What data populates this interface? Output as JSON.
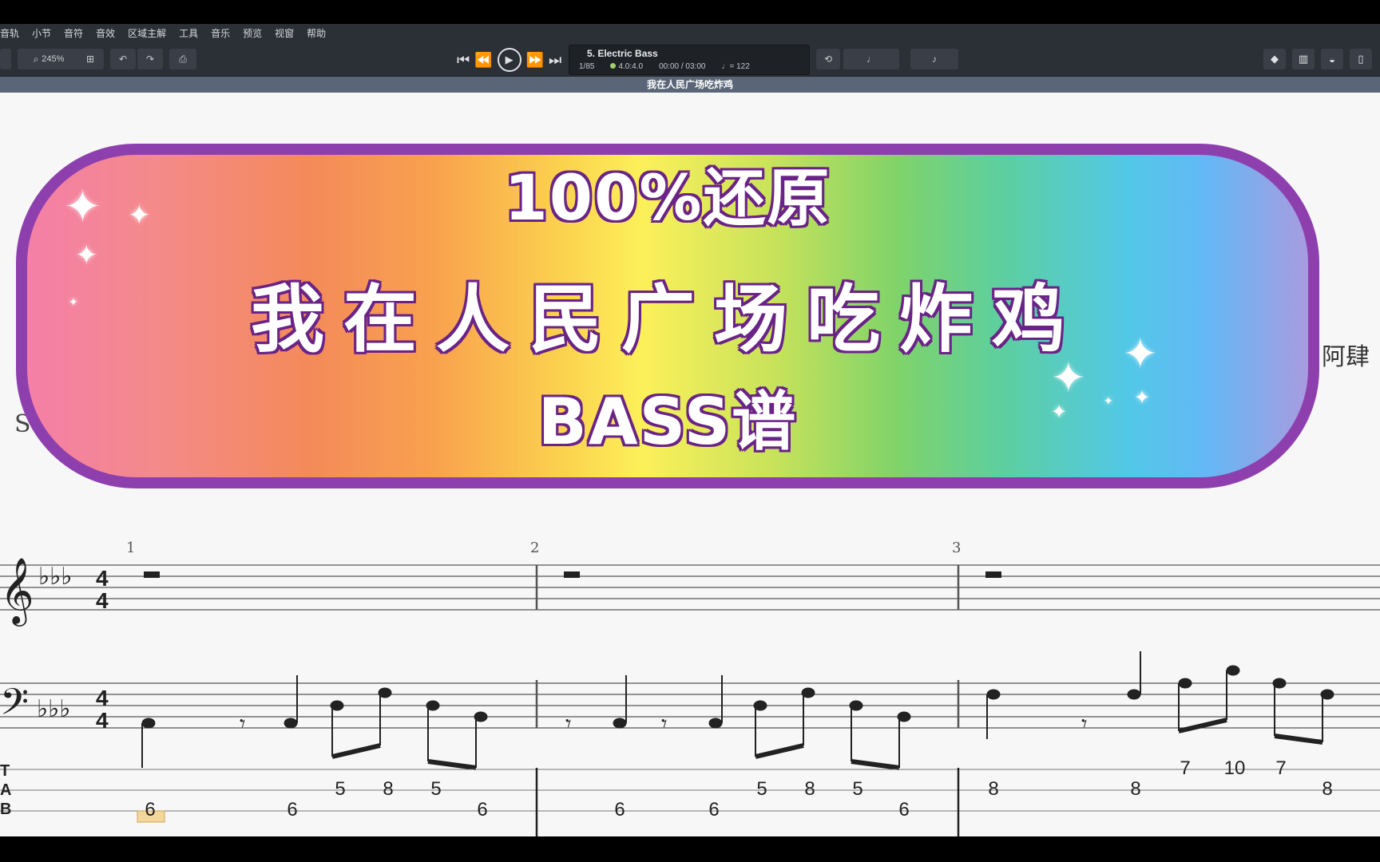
{
  "menu": [
    "音轨",
    "小节",
    "音符",
    "音效",
    "区域主解",
    "工具",
    "音乐",
    "预览",
    "视窗",
    "帮助"
  ],
  "toolbar": {
    "zoom": "245%"
  },
  "lcd": {
    "track": "5. Electric Bass",
    "bar": "1/85",
    "signature": "4.0:4.0",
    "time": "00:00 / 03:00",
    "tempo": "♩= 122"
  },
  "document_title": "我在人民广场吃炸鸡",
  "banner": {
    "line1": "100%还原",
    "line2": "我在人民广场吃炸鸡",
    "line3": "BASS谱"
  },
  "score": {
    "artist_partial": "阿肆",
    "partial_letter": "S",
    "time_signature": "4/4",
    "measure_numbers": [
      "1",
      "2",
      "3"
    ],
    "tab_labels": [
      "T",
      "A",
      "B"
    ],
    "tab_numbers": {
      "m1": [
        "6",
        "6",
        "5",
        "8",
        "5",
        "6"
      ],
      "m2": [
        "6",
        "6",
        "5",
        "8",
        "5",
        "6"
      ],
      "m3": [
        "8",
        "8",
        "7",
        "10",
        "7",
        "8"
      ]
    }
  }
}
